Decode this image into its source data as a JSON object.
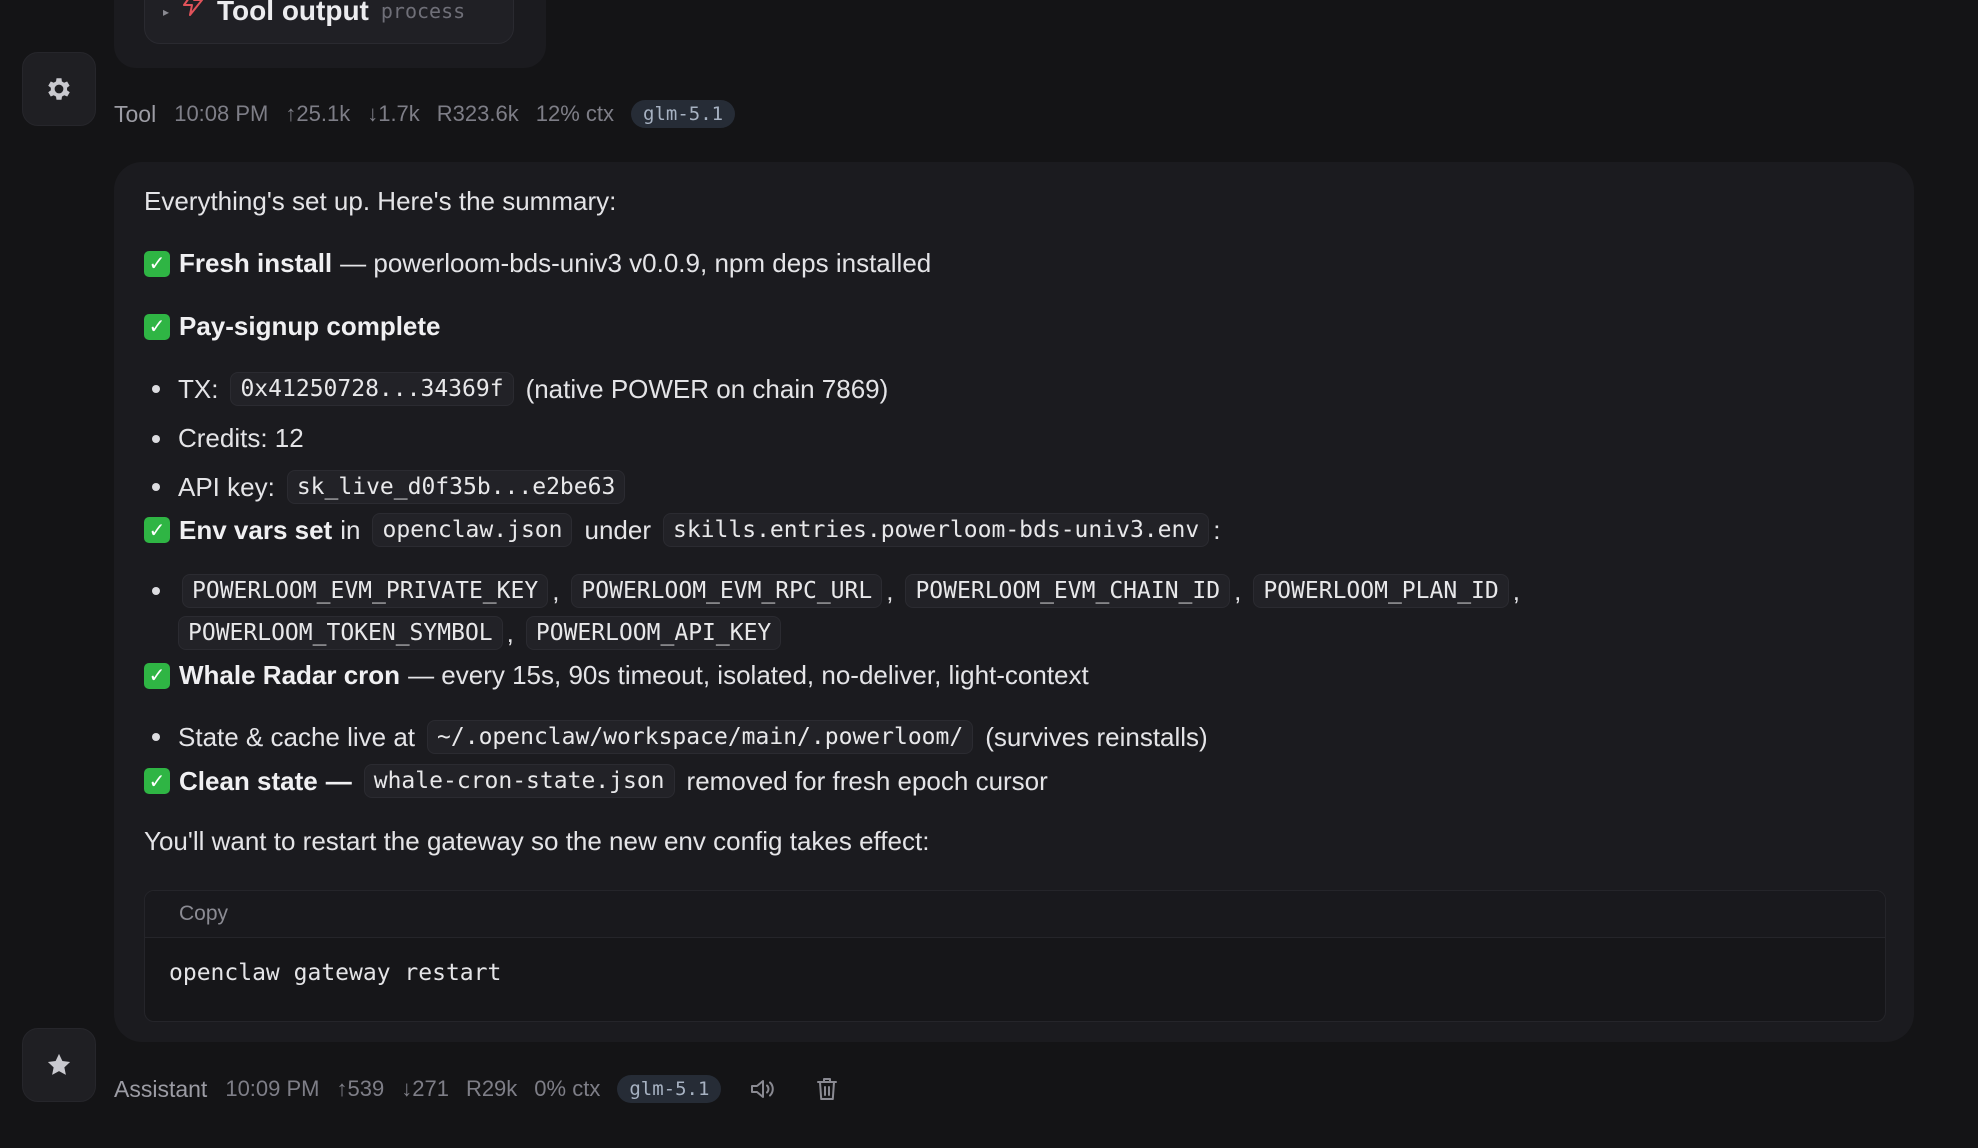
{
  "tool_output": {
    "title": "Tool output",
    "tag": "process"
  },
  "tool_meta": {
    "role": "Tool",
    "time": "10:08 PM",
    "tokens_in": "↑25.1k",
    "tokens_out": "↓1.7k",
    "reasoning": "R323.6k",
    "ctx": "12% ctx",
    "model": "glm-5.1"
  },
  "message": {
    "intro": "Everything's set up. Here's the summary:",
    "fresh_install": {
      "label": "Fresh install",
      "text": "— powerloom-bds-univ3 v0.0.9, npm deps installed"
    },
    "pay_signup": {
      "label": "Pay-signup complete",
      "tx_label": "TX:",
      "tx_value": "0x41250728...34369f",
      "tx_note": "(native POWER on chain 7869)",
      "credits": "Credits: 12",
      "api_label": "API key:",
      "api_value": "sk_live_d0f35b...e2be63"
    },
    "env_vars": {
      "label": "Env vars set",
      "in_text": "in",
      "file": "openclaw.json",
      "under_text": "under",
      "path": "skills.entries.powerloom-bds-univ3.env",
      "colon": ":",
      "vars": [
        "POWERLOOM_EVM_PRIVATE_KEY",
        "POWERLOOM_EVM_RPC_URL",
        "POWERLOOM_EVM_CHAIN_ID",
        "POWERLOOM_PLAN_ID",
        "POWERLOOM_TOKEN_SYMBOL",
        "POWERLOOM_API_KEY"
      ],
      "sep": ","
    },
    "whale_radar": {
      "label": "Whale Radar cron",
      "text": "— every 15s, 90s timeout, isolated, no-deliver, light-context",
      "state_text": "State & cache live at",
      "state_path": "~/.openclaw/workspace/main/.powerloom/",
      "state_note": "(survives reinstalls)"
    },
    "clean_state": {
      "label": "Clean state",
      "dash": "—",
      "file": "whale-cron-state.json",
      "text": "removed for fresh epoch cursor"
    },
    "restart_text": "You'll want to restart the gateway so the new env config takes effect:",
    "code_block": {
      "copy_label": "Copy",
      "command": "openclaw gateway restart"
    }
  },
  "assistant_meta": {
    "role": "Assistant",
    "time": "10:09 PM",
    "tokens_in": "↑539",
    "tokens_out": "↓271",
    "reasoning": "R29k",
    "ctx": "0% ctx",
    "model": "glm-5.1"
  },
  "icons": {
    "tool_avatar": "gear-icon",
    "assistant_avatar": "star-icon",
    "tool_output": "lightning-icon",
    "speak": "speaker-icon",
    "delete": "trash-icon"
  },
  "colors": {
    "background": "#141416",
    "bubble": "#1b1b1f",
    "check": "#2fb544",
    "model_badge": "#262c36",
    "lightning": "#e0525a"
  }
}
